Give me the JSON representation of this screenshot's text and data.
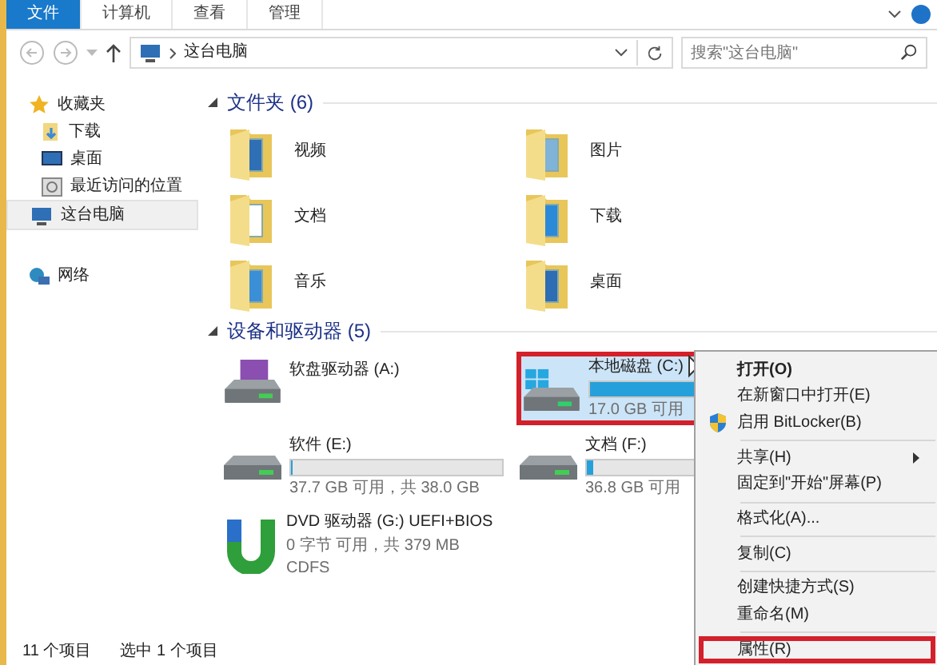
{
  "ribbon": {
    "tabs": [
      {
        "label": "文件",
        "kind": "file",
        "selected": false
      },
      {
        "label": "计算机",
        "kind": "tab",
        "selected": false
      },
      {
        "label": "查看",
        "kind": "tab",
        "selected": false
      },
      {
        "label": "管理",
        "kind": "tab",
        "selected": false
      }
    ]
  },
  "address": {
    "path": "这台电脑",
    "search": {
      "placeholder": "搜索\"这台电脑\""
    }
  },
  "sidebar": {
    "items": [
      {
        "label": "收藏夹",
        "kind": "star",
        "selected": false,
        "children": [
          {
            "label": "下载",
            "kind": "downloads",
            "selected": false
          },
          {
            "label": "桌面",
            "kind": "desktop",
            "selected": false
          },
          {
            "label": "最近访问的位置",
            "kind": "recent",
            "selected": false
          }
        ]
      },
      {
        "label": "这台电脑",
        "kind": "computer",
        "selected": true
      },
      {
        "label": "网络",
        "kind": "network",
        "selected": false
      }
    ]
  },
  "folders": {
    "title": "文件夹 (6)",
    "items": [
      {
        "name": "视频",
        "kind": "video"
      },
      {
        "name": "图片",
        "kind": "pictures"
      },
      {
        "name": "文档",
        "kind": "documents"
      },
      {
        "name": "下载",
        "kind": "downloads"
      },
      {
        "name": "音乐",
        "kind": "music"
      },
      {
        "name": "桌面",
        "kind": "desktop"
      }
    ]
  },
  "drives": {
    "title": "设备和驱动器 (5)",
    "items": [
      {
        "name": "软盘驱动器 (A:)",
        "kind": "floppy",
        "selected": false,
        "highlighted": false
      },
      {
        "name": "本地磁盘 (C:)",
        "kind": "system",
        "selected": true,
        "highlighted": true,
        "level": 0.66,
        "free": "17.0 GB 可用"
      },
      {
        "name": "软件 (E:)",
        "kind": "hdd",
        "selected": false,
        "highlighted": false,
        "level": 0.01,
        "free": "37.7 GB 可用，共 38.0 GB"
      },
      {
        "name": "文档 (F:)",
        "kind": "hdd",
        "selected": false,
        "highlighted": false,
        "level": 0.03,
        "free": "36.8 GB 可用"
      },
      {
        "name": "DVD 驱动器 (G:) UEFI+BIOS",
        "kind": "dvd",
        "selected": false,
        "highlighted": false,
        "free": "0 字节 可用，共 379 MB",
        "fs": "CDFS"
      }
    ]
  },
  "context_menu": {
    "items": [
      {
        "kind": "item",
        "label": "打开(O)",
        "bold": true,
        "shield": false,
        "submenu": false,
        "highlighted": false
      },
      {
        "kind": "item",
        "label": "在新窗口中打开(E)",
        "bold": false,
        "shield": false,
        "submenu": false,
        "highlighted": false
      },
      {
        "kind": "item",
        "label": "启用 BitLocker(B)",
        "bold": false,
        "shield": true,
        "submenu": false,
        "highlighted": false
      },
      {
        "kind": "separator"
      },
      {
        "kind": "item",
        "label": "共享(H)",
        "bold": false,
        "shield": false,
        "submenu": true,
        "highlighted": false
      },
      {
        "kind": "item",
        "label": "固定到\"开始\"屏幕(P)",
        "bold": false,
        "shield": false,
        "submenu": false,
        "highlighted": false
      },
      {
        "kind": "separator"
      },
      {
        "kind": "item",
        "label": "格式化(A)...",
        "bold": false,
        "shield": false,
        "submenu": false,
        "highlighted": false
      },
      {
        "kind": "separator"
      },
      {
        "kind": "item",
        "label": "复制(C)",
        "bold": false,
        "shield": false,
        "submenu": false,
        "highlighted": false
      },
      {
        "kind": "separator"
      },
      {
        "kind": "item",
        "label": "创建快捷方式(S)",
        "bold": false,
        "shield": false,
        "submenu": false,
        "highlighted": false
      },
      {
        "kind": "item",
        "label": "重命名(M)",
        "bold": false,
        "shield": false,
        "submenu": false,
        "highlighted": false
      },
      {
        "kind": "separator"
      },
      {
        "kind": "item",
        "label": "属性(R)",
        "bold": false,
        "shield": false,
        "submenu": false,
        "highlighted": true
      }
    ]
  },
  "status_bar": {
    "items": [
      "11 个项目",
      "选中 1 个项目"
    ]
  }
}
